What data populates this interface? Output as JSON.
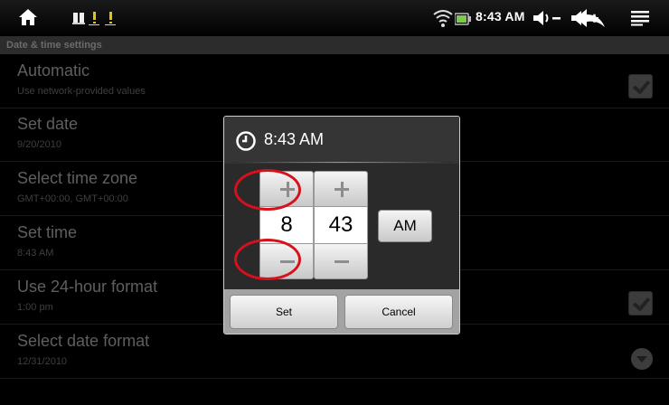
{
  "status_bar": {
    "time": "8:43 AM",
    "icons": [
      "home-icon",
      "notification-icon",
      "notification-warning-icon",
      "notification-warning-icon",
      "wifi-icon",
      "signal-icon",
      "battery-icon",
      "volume-down-icon",
      "volume-up-icon",
      "back-icon",
      "menu-icon"
    ]
  },
  "screen": {
    "title": "Date & time settings",
    "rows": [
      {
        "title": "Automatic",
        "subtitle": "Use network-provided values",
        "control": "checkbox",
        "checked": true
      },
      {
        "title": "Set date",
        "subtitle": "9/20/2010"
      },
      {
        "title": "Select time zone",
        "subtitle": "GMT+00:00, GMT+00:00"
      },
      {
        "title": "Set time",
        "subtitle": "8:43 AM"
      },
      {
        "title": "Use 24-hour format",
        "subtitle": "1:00 pm",
        "control": "checkbox",
        "checked": true
      },
      {
        "title": "Select date format",
        "subtitle": "12/31/2010",
        "control": "dropdown"
      }
    ]
  },
  "dialog": {
    "title": "8:43 AM",
    "hour": "8",
    "minute": "43",
    "ampm": "AM",
    "set_label": "Set",
    "cancel_label": "Cancel"
  },
  "colors": {
    "background": "#000000",
    "dim_text": "#5f5f5f",
    "annotation": "#d8101c"
  }
}
